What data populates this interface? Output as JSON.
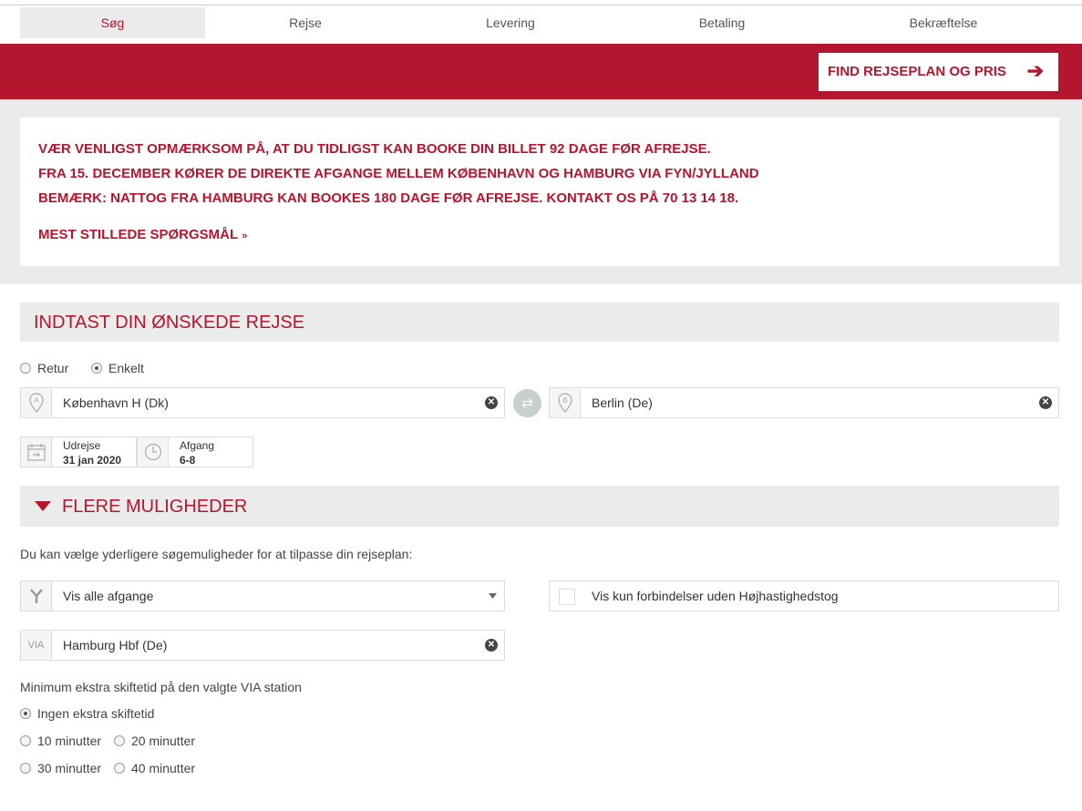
{
  "steps": [
    "Søg",
    "Rejse",
    "Levering",
    "Betaling",
    "Bekræftelse"
  ],
  "find_button": "FIND REJSEPLAN OG PRIS",
  "notice": {
    "lines": [
      "VÆR VENLIGST OPMÆRKSOM PÅ, AT DU TIDLIGST KAN BOOKE DIN BILLET 92 DAGE FØR AFREJSE.",
      "FRA 15. DECEMBER KØRER DE DIREKTE AFGANGE MELLEM KØBENHAVN OG HAMBURG VIA FYN/JYLLAND",
      "BEMÆRK: NATTOG FRA HAMBURG KAN BOOKES 180 DAGE FØR AFREJSE. KONTAKT OS PÅ 70 13 14 18."
    ],
    "faq": "MEST STILLEDE SPØRGSMÅL"
  },
  "journey": {
    "title": "INDTAST DIN ØNSKEDE REJSE",
    "trip_type": {
      "retur": "Retur",
      "enkelt": "Enkelt",
      "selected": "enkelt"
    },
    "from_marker": "A",
    "from": "København H (Dk)",
    "to_marker": "B",
    "to": "Berlin (De)",
    "date_label": "Udrejse",
    "date_value": "31 jan 2020",
    "time_label": "Afgang",
    "time_value": "6-8"
  },
  "more": {
    "title": "FLERE MULIGHEDER",
    "description": "Du kan vælge yderligere søgemuligheder for at tilpasse din rejseplan:",
    "departures_select": "Vis alle afgange",
    "no_highspeed_label": "Vis kun forbindelser uden Højhastighedstog",
    "via_label": "VIA",
    "via_value": "Hamburg Hbf (De)",
    "transfer_title": "Minimum ekstra skiftetid på den valgte VIA station",
    "transfer_options": [
      "Ingen ekstra skiftetid",
      "10 minutter",
      "20 minutter",
      "30 minutter",
      "40 minutter"
    ],
    "transfer_selected": 0
  },
  "colors": {
    "brand": "#b5162f"
  },
  "icons": [
    "arrow-right-icon",
    "chevron-double-down-icon",
    "pin-a-icon",
    "pin-b-icon",
    "swap-icon",
    "clear-icon",
    "calendar-icon",
    "clock-icon",
    "caret-down-icon",
    "route-icon"
  ]
}
